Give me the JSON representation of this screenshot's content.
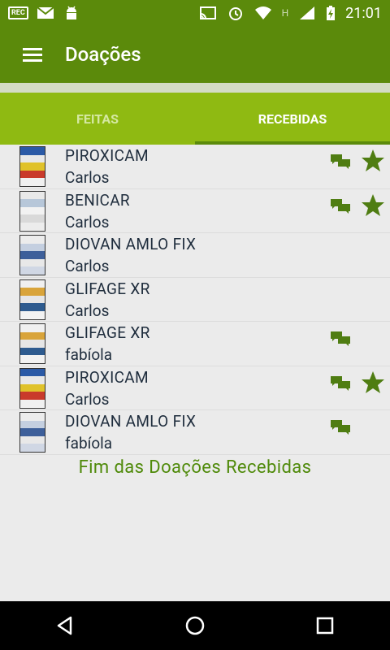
{
  "status_bar": {
    "time": "21:01",
    "rec_label": "REC",
    "network_label": "H",
    "icons": [
      "rec-icon",
      "mail-icon",
      "android-icon",
      "cast-icon",
      "alarm-icon",
      "wifi-icon",
      "signal-icon",
      "battery-icon"
    ]
  },
  "app_bar": {
    "title": "Doações",
    "menu_icon": "hamburger-icon"
  },
  "tabs": [
    {
      "label": "FEITAS",
      "selected": false
    },
    {
      "label": "RECEBIDAS",
      "selected": true
    }
  ],
  "donations": [
    {
      "medicine": "PIROXICAM",
      "donor": "Carlos",
      "has_chat": true,
      "has_star": true,
      "thumb": "piroxicam"
    },
    {
      "medicine": "BENICAR",
      "donor": "Carlos",
      "has_chat": true,
      "has_star": true,
      "thumb": "benicar"
    },
    {
      "medicine": "DIOVAN AMLO FIX",
      "donor": "Carlos",
      "has_chat": false,
      "has_star": false,
      "thumb": "diovan"
    },
    {
      "medicine": "GLIFAGE XR",
      "donor": "Carlos",
      "has_chat": false,
      "has_star": false,
      "thumb": "glifage"
    },
    {
      "medicine": "GLIFAGE XR",
      "donor": "fabíola",
      "has_chat": true,
      "has_star": false,
      "thumb": "glifage"
    },
    {
      "medicine": "PIROXICAM",
      "donor": "Carlos",
      "has_chat": true,
      "has_star": true,
      "thumb": "piroxicam"
    },
    {
      "medicine": "DIOVAN AMLO FIX",
      "donor": "fabíola",
      "has_chat": true,
      "has_star": false,
      "thumb": "diovan"
    }
  ],
  "end_message": "Fim das Doações Recebidas",
  "colors": {
    "primary": "#5b8a0b",
    "tab_bar": "#8fba12",
    "accent_icon": "#4f7d12",
    "end_text": "#4f8a0a"
  },
  "nav_bar": {
    "buttons": [
      "back-icon",
      "home-icon",
      "recents-icon"
    ]
  }
}
